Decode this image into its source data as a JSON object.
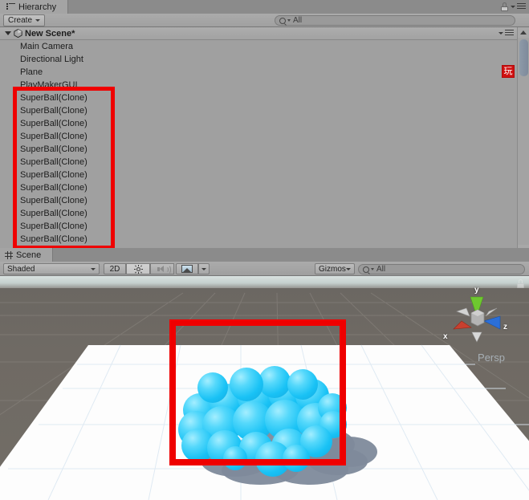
{
  "hierarchy": {
    "tab_label": "Hierarchy",
    "tab_icon": "hierarchy-list-icon",
    "lock_icon": "lock-icon",
    "panel_menu_icon": "panel-menu-icon",
    "create_button": "Create",
    "create_caret_icon": "chevron-down-icon",
    "search": {
      "icon": "search-icon",
      "value": "",
      "placeholder": "All"
    },
    "scene_root": {
      "label": "New Scene*",
      "foldout_icon": "foldout-expanded-icon",
      "unity_icon": "unity-scene-icon",
      "menu_icon": "scene-menu-icon"
    },
    "items": [
      {
        "label": "Main Camera"
      },
      {
        "label": "Directional Light"
      },
      {
        "label": "Plane"
      },
      {
        "label": "PlayMakerGUI"
      },
      {
        "label": "SuperBall(Clone)"
      },
      {
        "label": "SuperBall(Clone)"
      },
      {
        "label": "SuperBall(Clone)"
      },
      {
        "label": "SuperBall(Clone)"
      },
      {
        "label": "SuperBall(Clone)"
      },
      {
        "label": "SuperBall(Clone)"
      },
      {
        "label": "SuperBall(Clone)"
      },
      {
        "label": "SuperBall(Clone)"
      },
      {
        "label": "SuperBall(Clone)"
      },
      {
        "label": "SuperBall(Clone)"
      },
      {
        "label": "SuperBall(Clone)"
      },
      {
        "label": "SuperBall(Clone)"
      }
    ],
    "badge": {
      "text": "玩",
      "color": "#cf1111"
    },
    "scrollbar": {
      "up_icon": "scroll-up-arrow-icon",
      "down_icon": "scroll-down-arrow-icon",
      "thumb": "scrollbar-thumb"
    }
  },
  "scene": {
    "tab_label": "Scene",
    "tab_icon": "scene-grid-icon",
    "toolbar": {
      "draw_mode": "Shaded",
      "draw_mode_caret_icon": "chevron-down-icon",
      "toggle_2d": "2D",
      "lighting_icon": "sun-icon",
      "audio_icon": "speaker-mute-icon",
      "effects_icon": "image-effects-icon",
      "effects_caret_icon": "chevron-down-icon",
      "gizmos_label": "Gizmos",
      "gizmos_caret_icon": "chevron-down-icon",
      "search": {
        "icon": "search-icon",
        "value": "",
        "placeholder": "All"
      }
    },
    "gizmo": {
      "x_label": "x",
      "y_label": "y",
      "z_label": "z",
      "mode_label": "Persp",
      "lock_icon": "view-lock-icon",
      "x_color": "#c8402f",
      "y_color": "#6ec82f",
      "z_color": "#2b6fd8"
    },
    "viewport": {
      "ball_color": "#29c5f6",
      "ground_color": "#6f6a64",
      "plane_color": "#fdfdfd",
      "shadow_color": "#7e8a9b"
    }
  },
  "annotations": [
    {
      "name": "hierarchy-superball-highlight",
      "color": "#ef0000"
    },
    {
      "name": "scene-ball-cluster-highlight",
      "color": "#ef0000"
    }
  ]
}
